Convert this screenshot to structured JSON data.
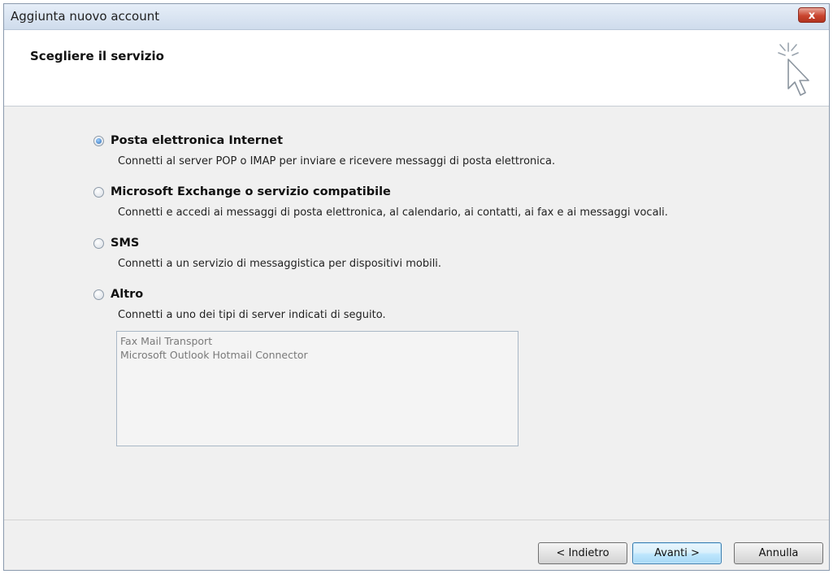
{
  "window": {
    "title": "Aggiunta nuovo account",
    "close_label": "x"
  },
  "header": {
    "title": "Scegliere il servizio"
  },
  "options": [
    {
      "label": "Posta elettronica Internet",
      "description": "Connetti al server POP o IMAP per inviare e ricevere messaggi di posta elettronica.",
      "selected": true
    },
    {
      "label": "Microsoft Exchange o servizio compatibile",
      "description": "Connetti e accedi ai messaggi di posta elettronica, al calendario, ai contatti, ai fax e ai messaggi vocali.",
      "selected": false
    },
    {
      "label": "SMS",
      "description": "Connetti a un servizio di messaggistica per dispositivi mobili.",
      "selected": false
    },
    {
      "label": "Altro",
      "description": "Connetti a uno dei tipi di server indicati di seguito.",
      "selected": false
    }
  ],
  "server_list": {
    "items": [
      "Fax Mail Transport",
      "Microsoft Outlook Hotmail Connector"
    ]
  },
  "footer": {
    "back_label": "< Indietro",
    "next_label": "Avanti >",
    "cancel_label": "Annulla"
  },
  "icons": {
    "wizard": "cursor-sparkle-icon",
    "close": "close-icon"
  },
  "colors": {
    "close_button": "#c9452f",
    "default_button_border": "#3c7fb1",
    "radio_dot": "#2f6db5"
  }
}
